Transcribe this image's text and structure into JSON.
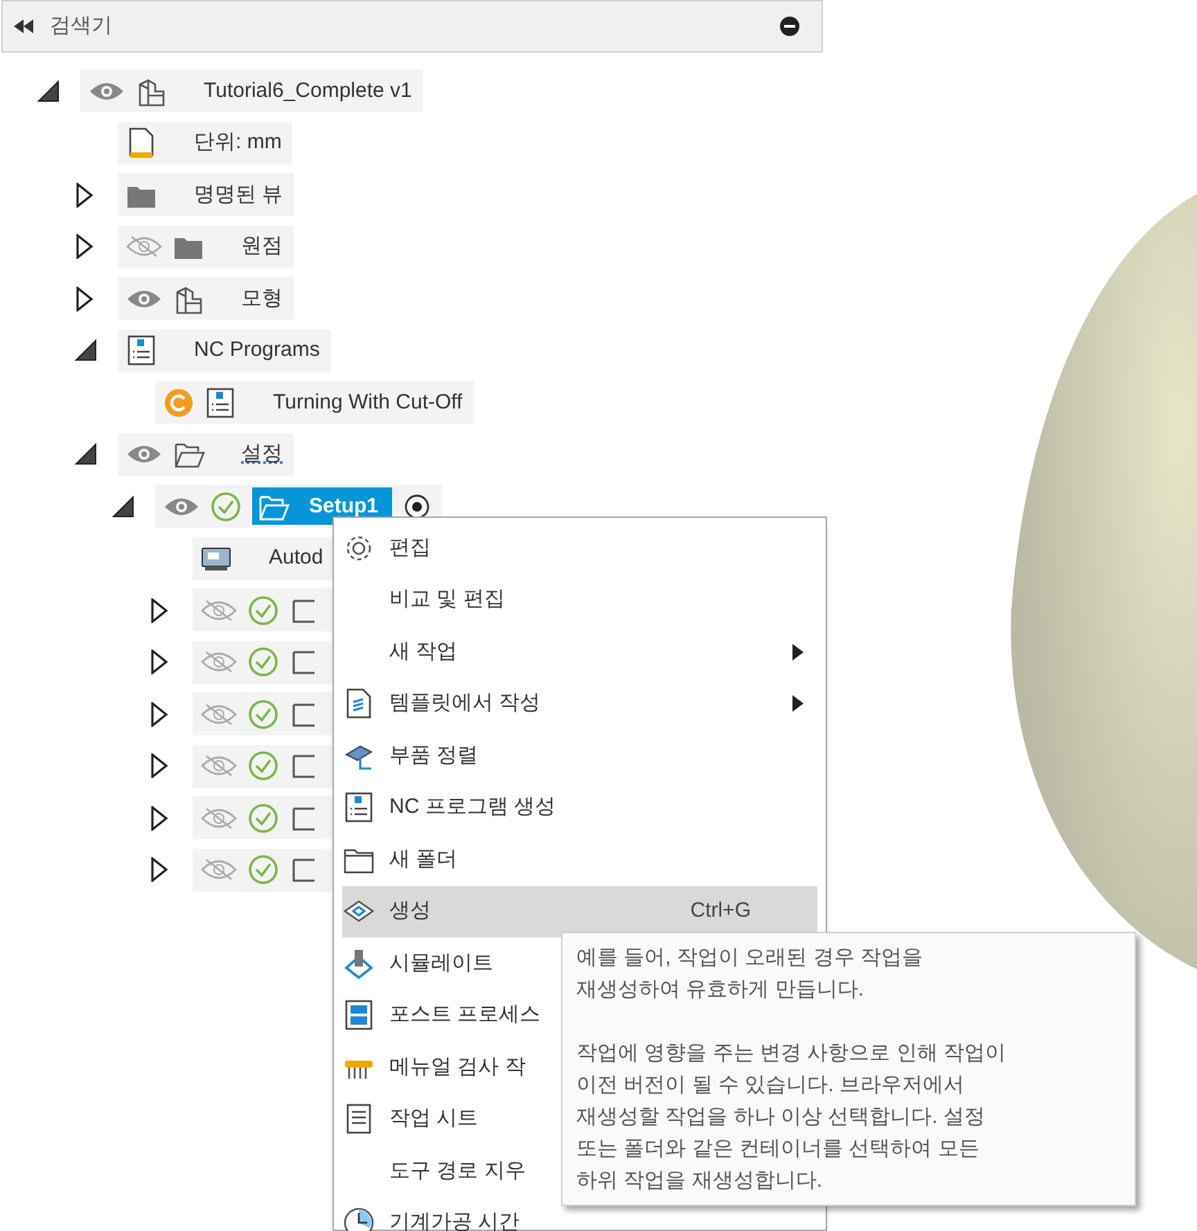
{
  "browser": {
    "title": "검색기"
  },
  "tree": [
    {
      "label": "Tutorial6_Complete v1",
      "kind": "component",
      "expanded": true,
      "visible": true,
      "selected": false,
      "children": [
        {
          "label": "단위: mm",
          "kind": "units",
          "selected": false
        },
        {
          "label": "명명된 뷰",
          "kind": "folder",
          "expanded": false,
          "selected": false
        },
        {
          "label": "원점",
          "kind": "folder",
          "expanded": false,
          "visible": false,
          "selected": false
        },
        {
          "label": "모형",
          "kind": "component",
          "expanded": false,
          "visible": true,
          "selected": false
        },
        {
          "label": "NC Programs",
          "kind": "nc",
          "expanded": true,
          "selected": false,
          "children": [
            {
              "label": "Turning With Cut-Off",
              "kind": "nc",
              "valid": false,
              "selected": false
            }
          ]
        },
        {
          "label": "설정",
          "kind": "setups",
          "expanded": true,
          "visible": true,
          "selected": false,
          "children": [
            {
              "label": "Setup1",
              "kind": "setup",
              "expanded": true,
              "visible": true,
              "valid": true,
              "selected": true,
              "children": [
                {
                  "label": "Autod",
                  "kind": "machine",
                  "selected": false
                },
                {
                  "kind": "operation",
                  "expanded": false,
                  "visible": false,
                  "valid": true,
                  "selected": false
                },
                {
                  "kind": "operation",
                  "expanded": false,
                  "visible": false,
                  "valid": true,
                  "selected": false
                },
                {
                  "kind": "operation",
                  "expanded": false,
                  "visible": false,
                  "valid": true,
                  "selected": false
                },
                {
                  "kind": "operation",
                  "expanded": false,
                  "visible": false,
                  "valid": true,
                  "selected": false
                },
                {
                  "kind": "operation",
                  "expanded": false,
                  "visible": false,
                  "valid": true,
                  "selected": false
                },
                {
                  "kind": "operation",
                  "expanded": false,
                  "visible": false,
                  "valid": true,
                  "selected": false
                }
              ]
            }
          ]
        }
      ]
    }
  ],
  "context_menu": [
    {
      "label": "편집",
      "submenu": false,
      "selected": false
    },
    {
      "label": "비교 및 편집",
      "submenu": false,
      "selected": false
    },
    {
      "label": "새 작업",
      "submenu": true,
      "selected": false
    },
    {
      "label": "템플릿에서 작성",
      "submenu": true,
      "selected": false
    },
    {
      "label": "부품 정렬",
      "submenu": false,
      "selected": false
    },
    {
      "label": "NC 프로그램 생성",
      "submenu": false,
      "selected": false
    },
    {
      "label": "새 폴더",
      "submenu": false,
      "selected": false
    },
    {
      "label": "생성",
      "shortcut": "Ctrl+G",
      "submenu": false,
      "selected": true
    },
    {
      "label": "시뮬레이트",
      "submenu": false,
      "selected": false
    },
    {
      "label": "포스트 프로세스",
      "submenu": false,
      "selected": false
    },
    {
      "label": "메뉴얼 검사 작",
      "submenu": false,
      "selected": false
    },
    {
      "label": "작업 시트",
      "submenu": false,
      "selected": false
    },
    {
      "label": "도구 경로 지우",
      "submenu": false,
      "selected": false
    },
    {
      "label": "기계가공 시간",
      "submenu": false,
      "selected": false
    }
  ],
  "tooltip": {
    "paragraphs": [
      "예를 들어, 작업이 오래된 경우 작업을\n재생성하여 유효하게 만듭니다.",
      "작업에 영향을 주는 변경 사항으로 인해 작업이\n이전 버전이 될 수 있습니다. 브라우저에서\n재생성할 작업을 하나 이상 선택합니다. 설정\n또는 폴더와 같은 컨테이너를 선택하여 모든\n하위 작업을 재생성합니다."
    ]
  }
}
